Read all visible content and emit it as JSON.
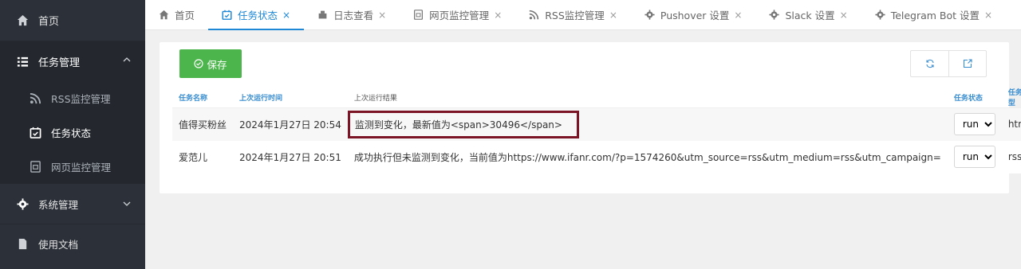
{
  "sidebar": {
    "home": "首页",
    "task_group": "任务管理",
    "sub_items": [
      "RSS监控管理",
      "任务状态",
      "网页监控管理"
    ],
    "system_group": "系统管理",
    "docs": "使用文档"
  },
  "tabs": [
    {
      "label": "首页",
      "icon": "home-icon",
      "closable": false
    },
    {
      "label": "任务状态",
      "icon": "calendar-check-icon",
      "closable": true,
      "active": true
    },
    {
      "label": "日志查看",
      "icon": "log-icon",
      "closable": true
    },
    {
      "label": "网页监控管理",
      "icon": "webpage-icon",
      "closable": true
    },
    {
      "label": "RSS监控管理",
      "icon": "rss-icon",
      "closable": true
    },
    {
      "label": "Pushover 设置",
      "icon": "gear-icon",
      "closable": true
    },
    {
      "label": "Slack 设置",
      "icon": "gear-icon",
      "closable": true
    },
    {
      "label": "Telegram Bot 设置",
      "icon": "gear-icon",
      "closable": true
    }
  ],
  "close_glyph": "×",
  "toolbar": {
    "save_label": "保存"
  },
  "table": {
    "headers": {
      "name": "任务名称",
      "last_run": "上次运行时间",
      "last_result": "上次运行结果",
      "status": "任务状态",
      "type": "任务类型"
    },
    "rows": [
      {
        "name": "值得买粉丝",
        "last_run": "2024年1月27日 20:54",
        "result": "监测到变化，最新值为<span>30496</span>",
        "status": "run",
        "type": "html"
      },
      {
        "name": "爱范儿",
        "last_run": "2024年1月27日 20:51",
        "result": "成功执行但未监测到变化，当前值为https://www.ifanr.com/?p=1574260&utm_source=rss&utm_medium=rss&utm_campaign=",
        "status": "run",
        "type": "rss"
      }
    ]
  },
  "colors": {
    "accent": "#1e88d6",
    "save_button": "#4cb64c",
    "highlight_border": "#7b1425",
    "sidebar": "#2c3139"
  }
}
